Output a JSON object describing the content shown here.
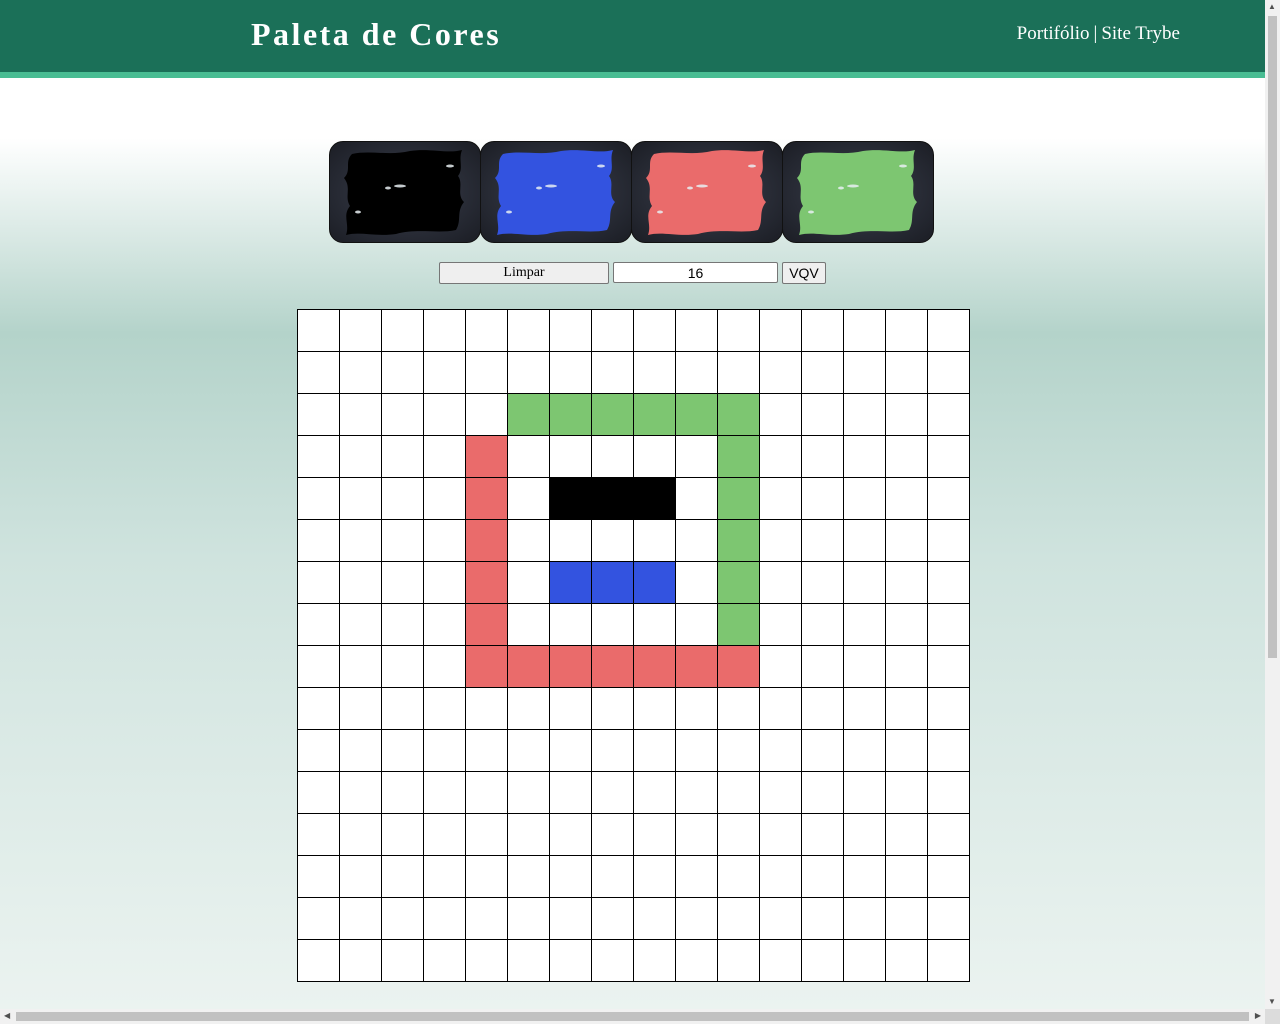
{
  "header": {
    "title": "Paleta de Cores",
    "links": [
      "Portifólio",
      "Site Trybe"
    ],
    "separator": "|"
  },
  "palette": [
    {
      "name": "black",
      "color": "#000000"
    },
    {
      "name": "blue",
      "color": "#3353e0"
    },
    {
      "name": "red",
      "color": "#ea6b6b"
    },
    {
      "name": "green",
      "color": "#7dc671"
    }
  ],
  "controls": {
    "clear_label": "Limpar",
    "size_value": "16",
    "vqv_label": "VQV"
  },
  "board": {
    "size": 16,
    "empty_color": "#ffffff",
    "rows": [
      "................",
      "................",
      ".....GGGGGG.....",
      "....R.....G.....",
      "....R.KKK.G.....",
      "....R.....G.....",
      "....R.BBB.G.....",
      "....R.....G.....",
      "....RRRRRRR.....",
      "................",
      "................",
      "................",
      "................",
      "................",
      "................",
      "................"
    ],
    "legend": {
      "K": "#000000",
      "B": "#3353e0",
      "R": "#ea6b6b",
      "G": "#7dc671"
    }
  },
  "icons": {
    "scroll_up": "▲",
    "scroll_down": "▼",
    "scroll_left": "◀",
    "scroll_right": "▶"
  }
}
